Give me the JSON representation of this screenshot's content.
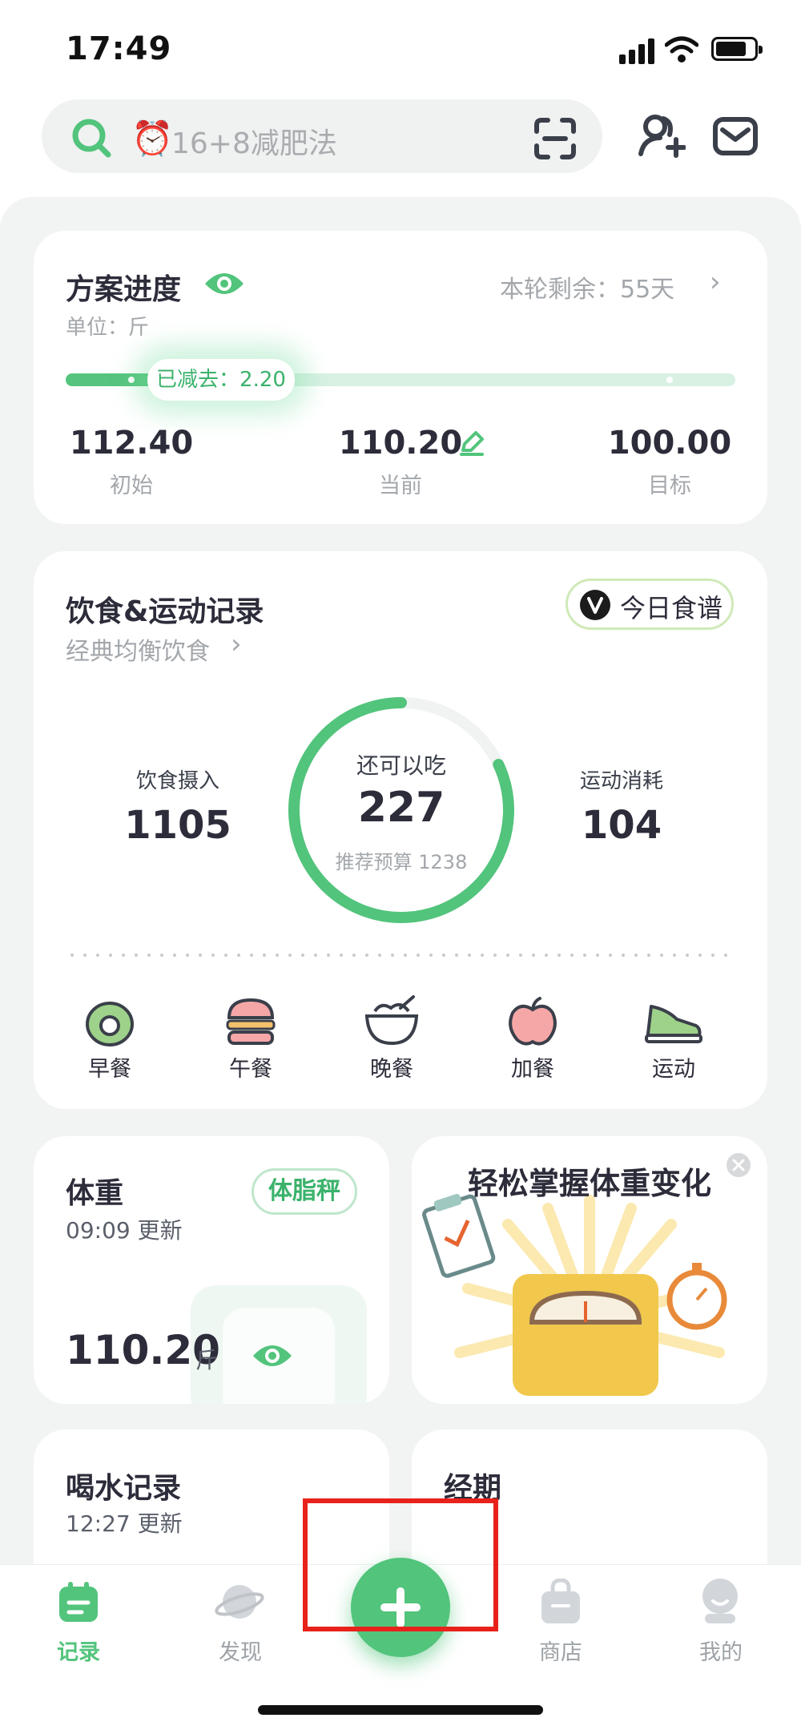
{
  "status_bar": {
    "time": "17:49"
  },
  "search": {
    "emoji": "⏰",
    "placeholder": "16+8减肥法"
  },
  "plan": {
    "title": "方案进度",
    "unit": "单位：斤",
    "remaining": "本轮剩余：55天",
    "lost_label": "已减去：2.20",
    "progress": 0.2,
    "start_value": "112.40",
    "start_label": "初始",
    "current_value": "110.20",
    "current_label": "当前",
    "target_value": "100.00",
    "target_label": "目标"
  },
  "diet": {
    "title": "饮食&运动记录",
    "subtitle": "经典均衡饮食",
    "recipe_button": "今日食谱",
    "intake_label": "饮食摄入",
    "intake_value": "1105",
    "remaining_label": "还可以吃",
    "remaining_value": "227",
    "budget_text": "推荐预算 1238",
    "exercise_label": "运动消耗",
    "exercise_value": "104",
    "ring_fraction": 0.82,
    "meals": [
      "早餐",
      "午餐",
      "晚餐",
      "加餐",
      "运动"
    ]
  },
  "weight": {
    "title": "体重",
    "updated": "09:09 更新",
    "scale_button": "体脂秤",
    "value": "110.20",
    "unit": "斤"
  },
  "promo": {
    "title": "轻松掌握体重变化"
  },
  "water": {
    "title": "喝水记录",
    "updated": "12:27 更新"
  },
  "period": {
    "title": "经期"
  },
  "tabs": {
    "record": "记录",
    "discover": "发现",
    "shop": "商店",
    "mine": "我的"
  },
  "colors": {
    "accent": "#52c47c",
    "highlight_box": "#e8221b"
  }
}
